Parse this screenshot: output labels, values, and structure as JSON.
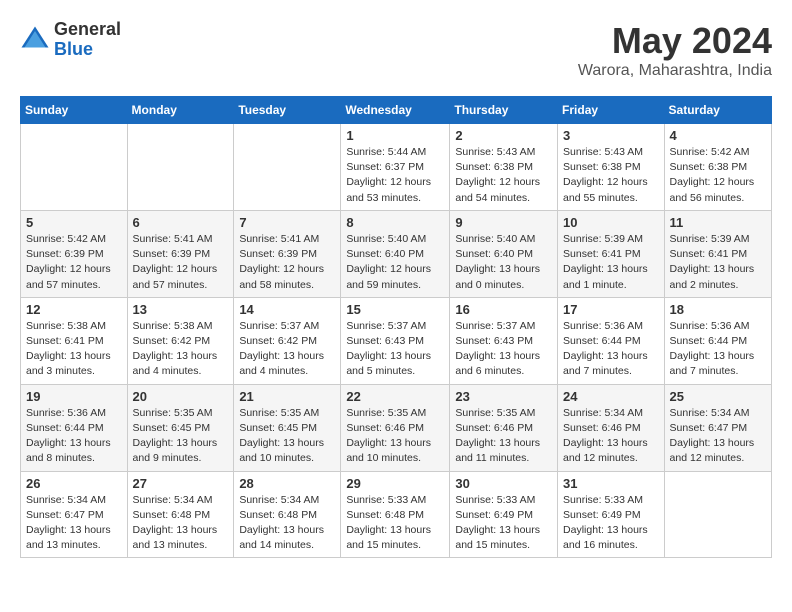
{
  "header": {
    "logo_general": "General",
    "logo_blue": "Blue",
    "month": "May 2024",
    "location": "Warora, Maharashtra, India"
  },
  "weekdays": [
    "Sunday",
    "Monday",
    "Tuesday",
    "Wednesday",
    "Thursday",
    "Friday",
    "Saturday"
  ],
  "weeks": [
    [
      {
        "day": "",
        "info": ""
      },
      {
        "day": "",
        "info": ""
      },
      {
        "day": "",
        "info": ""
      },
      {
        "day": "1",
        "info": "Sunrise: 5:44 AM\nSunset: 6:37 PM\nDaylight: 12 hours\nand 53 minutes."
      },
      {
        "day": "2",
        "info": "Sunrise: 5:43 AM\nSunset: 6:38 PM\nDaylight: 12 hours\nand 54 minutes."
      },
      {
        "day": "3",
        "info": "Sunrise: 5:43 AM\nSunset: 6:38 PM\nDaylight: 12 hours\nand 55 minutes."
      },
      {
        "day": "4",
        "info": "Sunrise: 5:42 AM\nSunset: 6:38 PM\nDaylight: 12 hours\nand 56 minutes."
      }
    ],
    [
      {
        "day": "5",
        "info": "Sunrise: 5:42 AM\nSunset: 6:39 PM\nDaylight: 12 hours\nand 57 minutes."
      },
      {
        "day": "6",
        "info": "Sunrise: 5:41 AM\nSunset: 6:39 PM\nDaylight: 12 hours\nand 57 minutes."
      },
      {
        "day": "7",
        "info": "Sunrise: 5:41 AM\nSunset: 6:39 PM\nDaylight: 12 hours\nand 58 minutes."
      },
      {
        "day": "8",
        "info": "Sunrise: 5:40 AM\nSunset: 6:40 PM\nDaylight: 12 hours\nand 59 minutes."
      },
      {
        "day": "9",
        "info": "Sunrise: 5:40 AM\nSunset: 6:40 PM\nDaylight: 13 hours\nand 0 minutes."
      },
      {
        "day": "10",
        "info": "Sunrise: 5:39 AM\nSunset: 6:41 PM\nDaylight: 13 hours\nand 1 minute."
      },
      {
        "day": "11",
        "info": "Sunrise: 5:39 AM\nSunset: 6:41 PM\nDaylight: 13 hours\nand 2 minutes."
      }
    ],
    [
      {
        "day": "12",
        "info": "Sunrise: 5:38 AM\nSunset: 6:41 PM\nDaylight: 13 hours\nand 3 minutes."
      },
      {
        "day": "13",
        "info": "Sunrise: 5:38 AM\nSunset: 6:42 PM\nDaylight: 13 hours\nand 4 minutes."
      },
      {
        "day": "14",
        "info": "Sunrise: 5:37 AM\nSunset: 6:42 PM\nDaylight: 13 hours\nand 4 minutes."
      },
      {
        "day": "15",
        "info": "Sunrise: 5:37 AM\nSunset: 6:43 PM\nDaylight: 13 hours\nand 5 minutes."
      },
      {
        "day": "16",
        "info": "Sunrise: 5:37 AM\nSunset: 6:43 PM\nDaylight: 13 hours\nand 6 minutes."
      },
      {
        "day": "17",
        "info": "Sunrise: 5:36 AM\nSunset: 6:44 PM\nDaylight: 13 hours\nand 7 minutes."
      },
      {
        "day": "18",
        "info": "Sunrise: 5:36 AM\nSunset: 6:44 PM\nDaylight: 13 hours\nand 7 minutes."
      }
    ],
    [
      {
        "day": "19",
        "info": "Sunrise: 5:36 AM\nSunset: 6:44 PM\nDaylight: 13 hours\nand 8 minutes."
      },
      {
        "day": "20",
        "info": "Sunrise: 5:35 AM\nSunset: 6:45 PM\nDaylight: 13 hours\nand 9 minutes."
      },
      {
        "day": "21",
        "info": "Sunrise: 5:35 AM\nSunset: 6:45 PM\nDaylight: 13 hours\nand 10 minutes."
      },
      {
        "day": "22",
        "info": "Sunrise: 5:35 AM\nSunset: 6:46 PM\nDaylight: 13 hours\nand 10 minutes."
      },
      {
        "day": "23",
        "info": "Sunrise: 5:35 AM\nSunset: 6:46 PM\nDaylight: 13 hours\nand 11 minutes."
      },
      {
        "day": "24",
        "info": "Sunrise: 5:34 AM\nSunset: 6:46 PM\nDaylight: 13 hours\nand 12 minutes."
      },
      {
        "day": "25",
        "info": "Sunrise: 5:34 AM\nSunset: 6:47 PM\nDaylight: 13 hours\nand 12 minutes."
      }
    ],
    [
      {
        "day": "26",
        "info": "Sunrise: 5:34 AM\nSunset: 6:47 PM\nDaylight: 13 hours\nand 13 minutes."
      },
      {
        "day": "27",
        "info": "Sunrise: 5:34 AM\nSunset: 6:48 PM\nDaylight: 13 hours\nand 13 minutes."
      },
      {
        "day": "28",
        "info": "Sunrise: 5:34 AM\nSunset: 6:48 PM\nDaylight: 13 hours\nand 14 minutes."
      },
      {
        "day": "29",
        "info": "Sunrise: 5:33 AM\nSunset: 6:48 PM\nDaylight: 13 hours\nand 15 minutes."
      },
      {
        "day": "30",
        "info": "Sunrise: 5:33 AM\nSunset: 6:49 PM\nDaylight: 13 hours\nand 15 minutes."
      },
      {
        "day": "31",
        "info": "Sunrise: 5:33 AM\nSunset: 6:49 PM\nDaylight: 13 hours\nand 16 minutes."
      },
      {
        "day": "",
        "info": ""
      }
    ]
  ]
}
